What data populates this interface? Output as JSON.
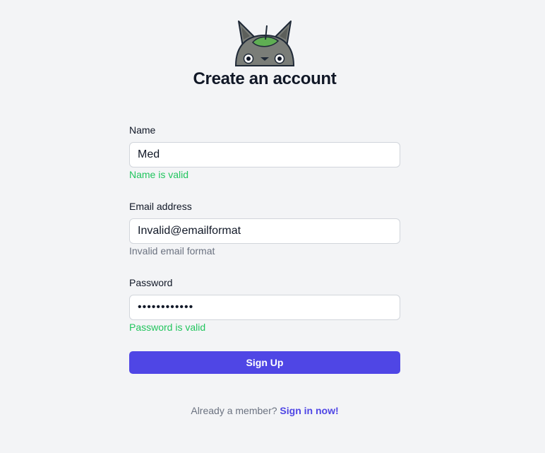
{
  "header": {
    "logo_icon": "totoro-logo-icon",
    "title": "Create an account"
  },
  "form": {
    "name": {
      "label": "Name",
      "value": "Med",
      "helper": "Name is valid",
      "helper_status": "valid"
    },
    "email": {
      "label": "Email address",
      "value": "Invalid@emailformat",
      "helper": "Invalid email format",
      "helper_status": "invalid"
    },
    "password": {
      "label": "Password",
      "value": "passwordtest",
      "helper": "Password is valid",
      "helper_status": "valid"
    },
    "submit_label": "Sign Up"
  },
  "footer": {
    "prompt": "Already a member? ",
    "link_label": "Sign in now!"
  },
  "colors": {
    "background": "#f3f4f6",
    "accent": "#4f46e5",
    "valid": "#22c55e",
    "muted": "#6b7280"
  }
}
